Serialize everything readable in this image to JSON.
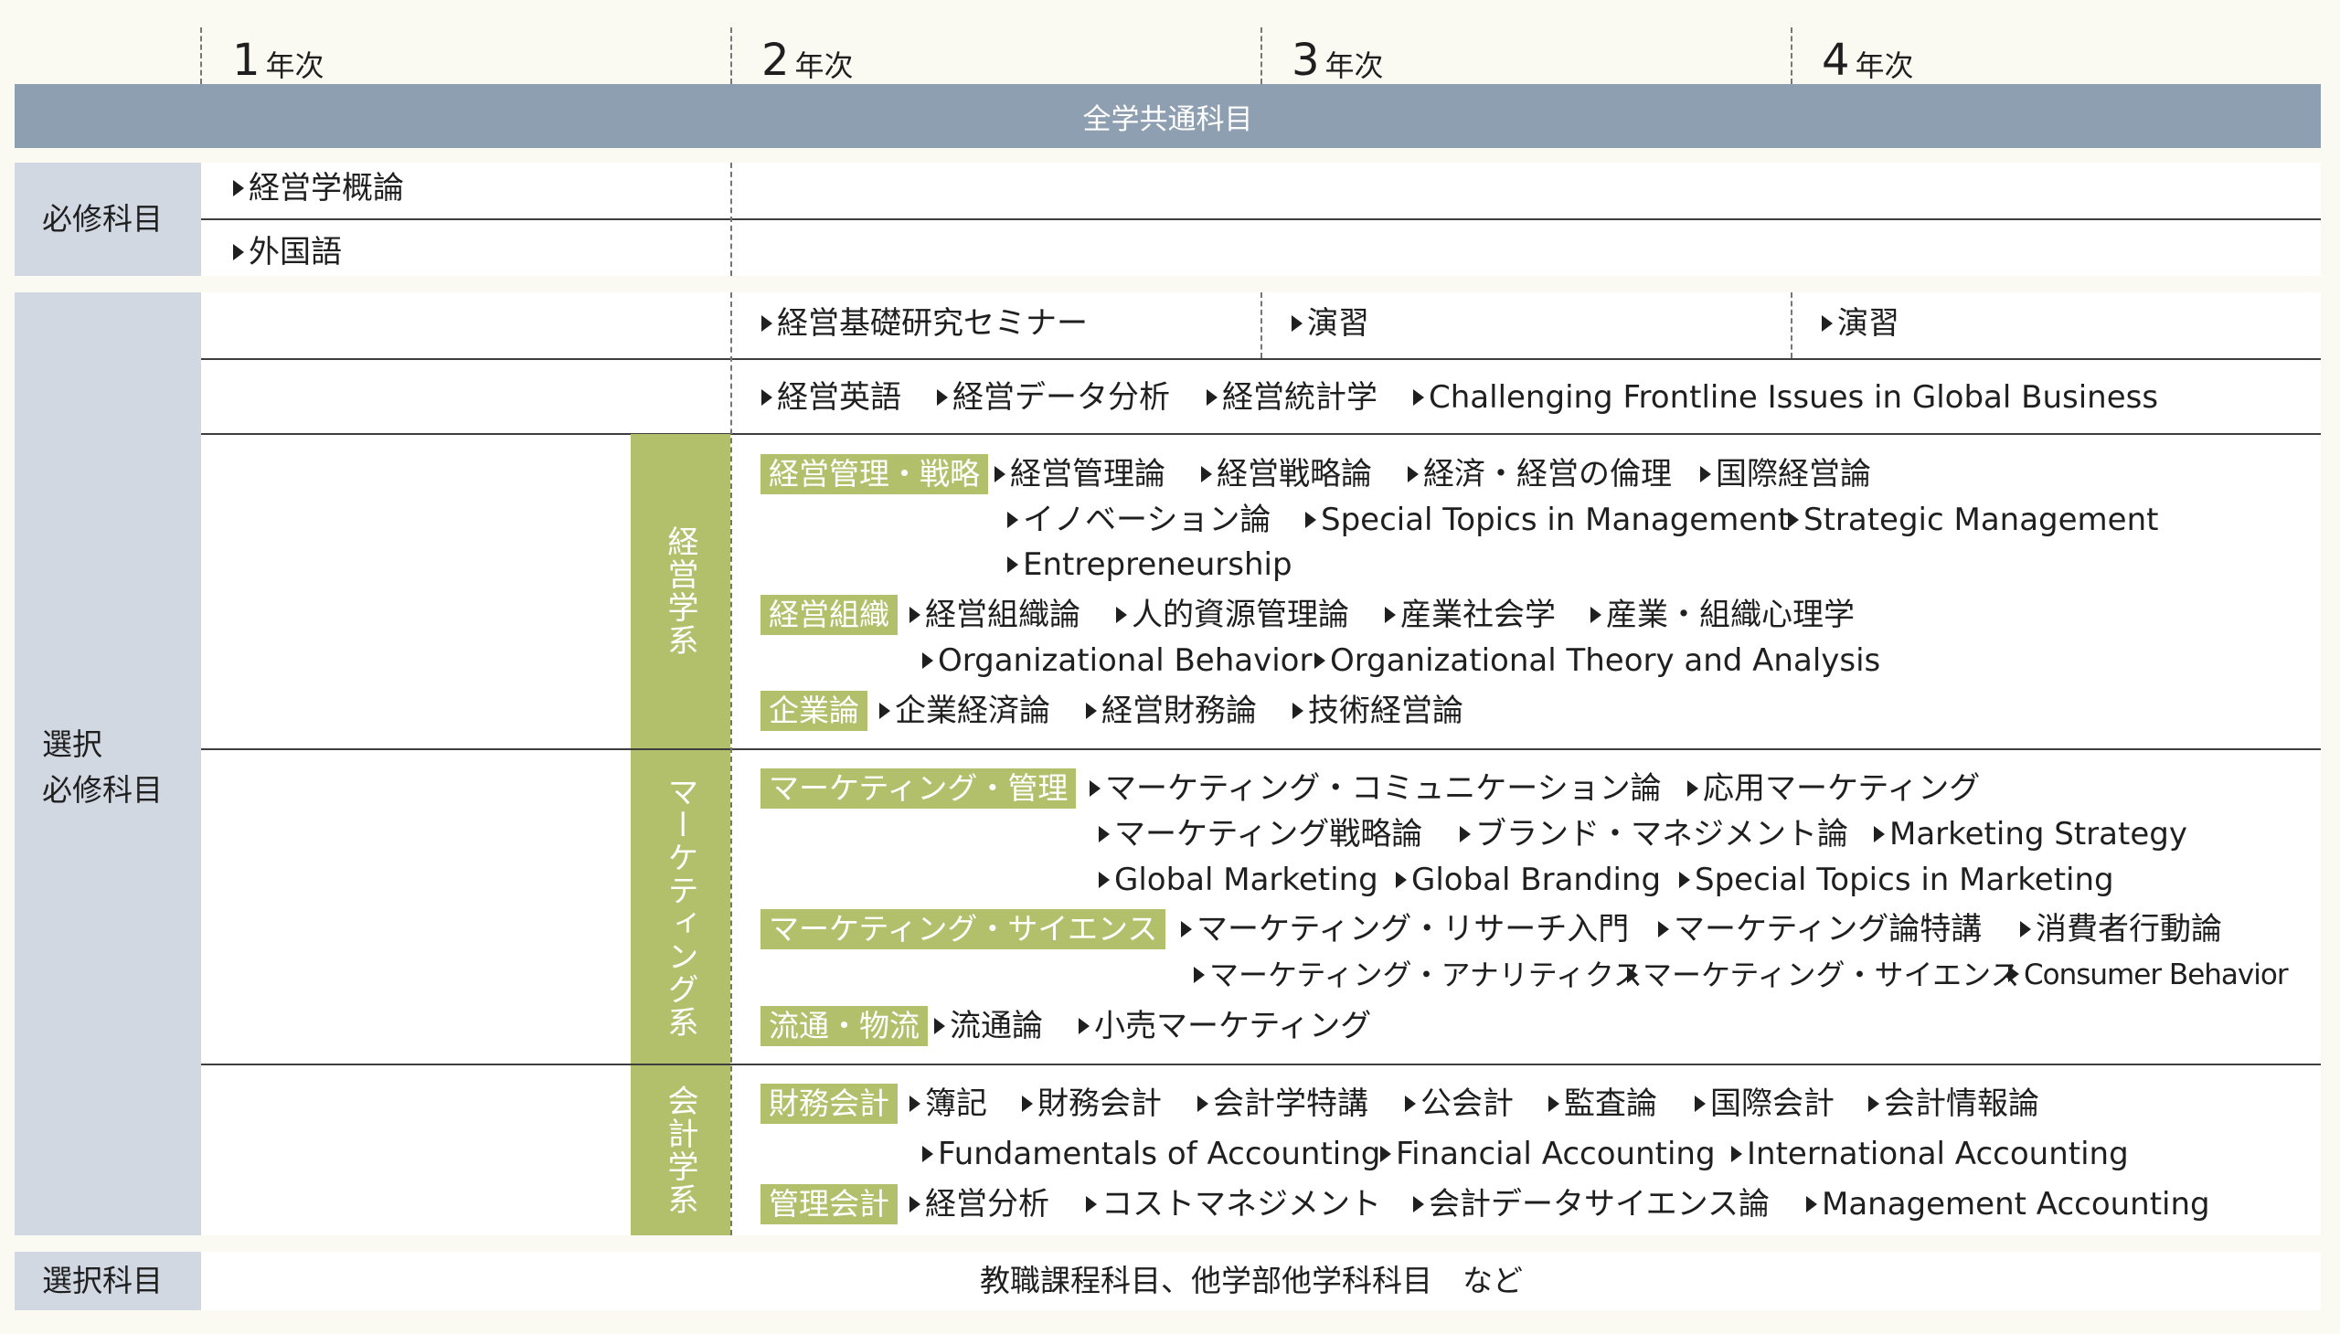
{
  "years": [
    {
      "num": "1",
      "suffix": "年次"
    },
    {
      "num": "2",
      "suffix": "年次"
    },
    {
      "num": "3",
      "suffix": "年次"
    },
    {
      "num": "4",
      "suffix": "年次"
    }
  ],
  "common_band": "全学共通科目",
  "categories": {
    "required": "必修科目",
    "elective_required_line1": "選択",
    "elective_required_line2": "必修科目",
    "elective": "選択科目"
  },
  "required_courses": [
    "経営学概論",
    "外国語"
  ],
  "seminar_row": [
    "経営基礎研究セミナー",
    "演習",
    "演習"
  ],
  "common_row": [
    "経営英語",
    "経営データ分析",
    "経営統計学",
    "Challenging Frontline Issues in Global Business"
  ],
  "streams": {
    "management": "経営学系",
    "marketing": "マーケティング系",
    "accounting": "会計学系"
  },
  "tags": {
    "mgmt_strategy": "経営管理・戦略",
    "org": "経営組織",
    "enterprise": "企業論",
    "mkt_mgmt": "マーケティング・管理",
    "mkt_science": "マーケティング・サイエンス",
    "distribution": "流通・物流",
    "fin_acct": "財務会計",
    "mgmt_acct": "管理会計"
  },
  "courses": {
    "mgmt_strategy_1": [
      "経営管理論",
      "経営戦略論",
      "経済・経営の倫理",
      "国際経営論"
    ],
    "mgmt_strategy_2": [
      "イノベーション論",
      "Special Topics in Management",
      "Strategic Management"
    ],
    "mgmt_strategy_3": [
      "Entrepreneurship"
    ],
    "org_1": [
      "経営組織論",
      "人的資源管理論",
      "産業社会学",
      "産業・組織心理学"
    ],
    "org_2": [
      "Organizational Behavior",
      "Organizational Theory and Analysis"
    ],
    "enterprise_1": [
      "企業経済論",
      "経営財務論",
      "技術経営論"
    ],
    "mkt_mgmt_1": [
      "マーケティング・コミュニケーション論",
      "応用マーケティング"
    ],
    "mkt_mgmt_2": [
      "マーケティング戦略論",
      "ブランド・マネジメント論",
      "Marketing Strategy"
    ],
    "mkt_mgmt_3": [
      "Global Marketing",
      "Global Branding",
      "Special Topics in Marketing"
    ],
    "mkt_science_1": [
      "マーケティング・リサーチ入門",
      "マーケティング論特講",
      "消費者行動論"
    ],
    "mkt_science_2": [
      "マーケティング・アナリティクス",
      "マーケティング・サイエンス",
      "Consumer Behavior"
    ],
    "distribution_1": [
      "流通論",
      "小売マーケティング"
    ],
    "fin_acct_1": [
      "簿記",
      "財務会計",
      "会計学特講",
      "公会計",
      "監査論",
      "国際会計",
      "会計情報論"
    ],
    "fin_acct_2": [
      "Fundamentals of Accounting",
      "Financial Accounting",
      "International Accounting"
    ],
    "mgmt_acct_1": [
      "経営分析",
      "コストマネジメント",
      "会計データサイエンス論",
      "Management Accounting"
    ]
  },
  "elective_text": "教職課程科目、他学部他学科科目　など"
}
